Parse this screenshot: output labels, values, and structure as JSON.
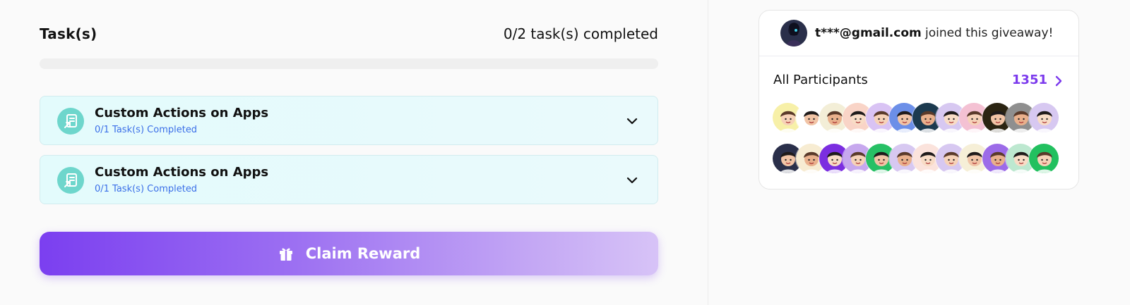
{
  "tasks": {
    "title": "Task(s)",
    "progress_text": "0/2 task(s) completed",
    "completed": 0,
    "total": 2,
    "progress_fraction": 0,
    "items": [
      {
        "title": "Custom Actions on Apps",
        "subtitle": "0/1 Task(s) Completed",
        "icon": "custom-actions-icon"
      },
      {
        "title": "Custom Actions on Apps",
        "subtitle": "0/1 Task(s) Completed",
        "icon": "custom-actions-icon"
      }
    ]
  },
  "claim": {
    "label": "Claim Reward",
    "icon": "gift-icon"
  },
  "activity": {
    "email": "t***@gmail.com",
    "text": "joined this giveaway!"
  },
  "participants": {
    "label": "All Participants",
    "count": "1351",
    "row1": [
      "#f7f0a8",
      "#ffffff",
      "#f3eed7",
      "#f9d4c7",
      "#d9c3f4",
      "#6c8fe8",
      "#1c3a4f",
      "#d7c8f1",
      "#f4c1d3",
      "#2b2412",
      "#8f8f8f",
      "#d7c8f1"
    ],
    "row2": [
      "#2a2f4a",
      "#f7ecd2",
      "#7b2ee0",
      "#c7a8ee",
      "#27c065",
      "#d7c8f1",
      "#fbe3dc",
      "#d7c8f1",
      "#f6efd7",
      "#9c6be8",
      "#bde8d0",
      "#22c05f"
    ]
  },
  "colors": {
    "accent": "#7c3aed",
    "task_card_bg": "#e3fbfc",
    "task_icon_bg": "#6ed6cc",
    "task_sub": "#3b6fe8"
  }
}
